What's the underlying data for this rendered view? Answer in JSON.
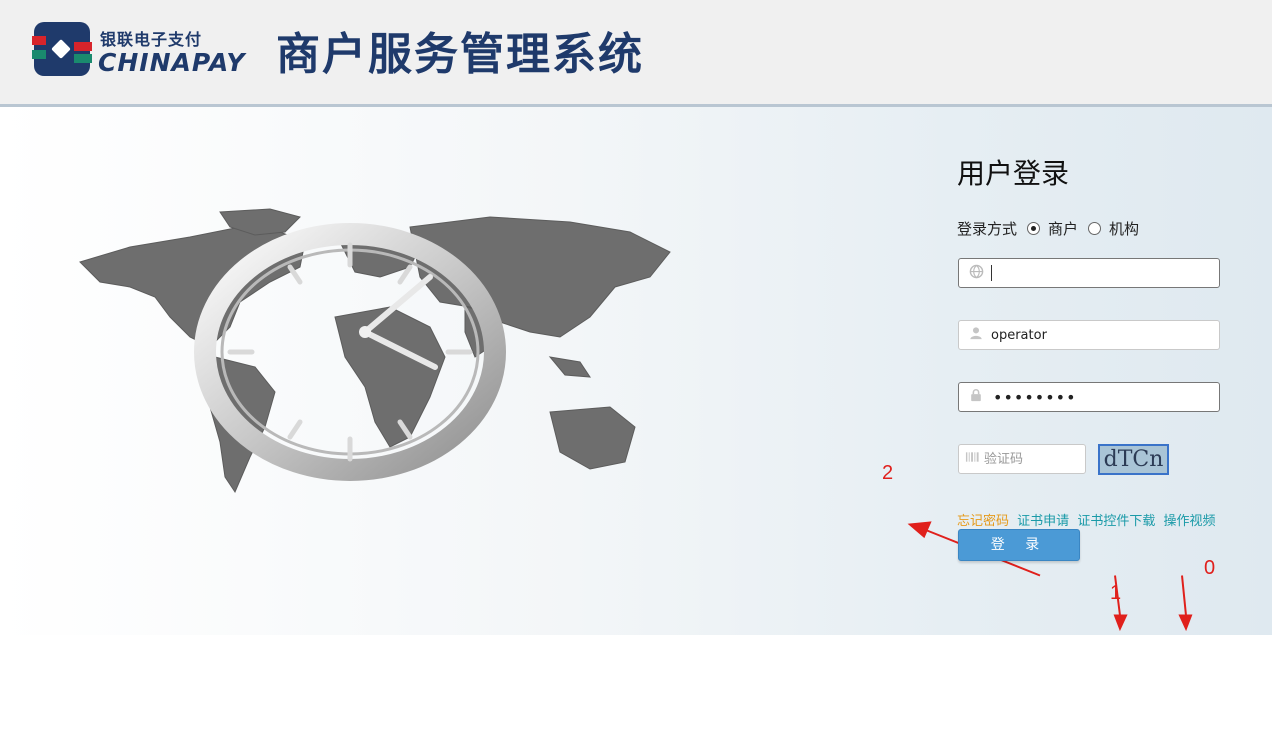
{
  "header": {
    "logo_cn": "银联电子支付",
    "logo_en": "CHINAPAY",
    "system_title": "商户服务管理系统",
    "logo_colors": {
      "box": "#1f3a6b",
      "red": "#d7242b",
      "green": "#1a8a6e"
    }
  },
  "login": {
    "title": "用户登录",
    "mode_label": "登录方式",
    "mode_options": [
      "商户",
      "机构"
    ],
    "mode_selected": "商户",
    "merchant_field": {
      "icon": "globe-icon",
      "value": ""
    },
    "username_field": {
      "icon": "user-icon",
      "value": "operator"
    },
    "password_field": {
      "icon": "lock-icon",
      "value": "••••••••"
    },
    "captcha_field": {
      "icon": "barcode-icon",
      "placeholder": "验证码"
    },
    "captcha_image_text": "dTCn",
    "links": {
      "forgot": "忘记密码",
      "cert_apply": "证书申请",
      "cert_download": "证书控件下载",
      "video": "操作视频"
    },
    "submit_label": "登 录"
  },
  "annotations": [
    "2",
    "1",
    "0"
  ]
}
